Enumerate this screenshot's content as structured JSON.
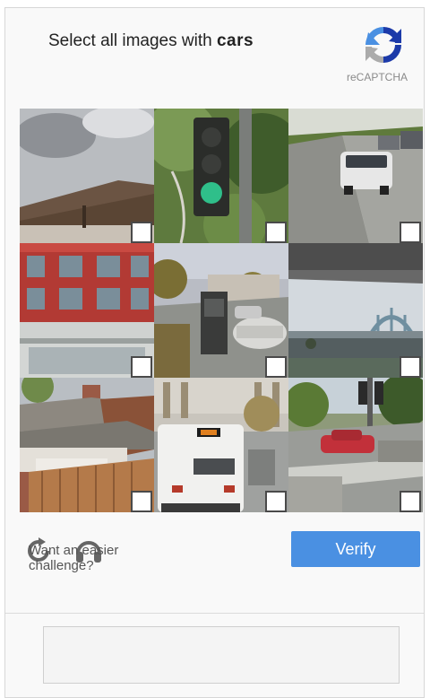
{
  "header": {
    "instruction_prefix": "Select all images with ",
    "target_word": "cars",
    "brand_text": "reCAPTCHA"
  },
  "grid": {
    "tiles": [
      {
        "name": "building-roof",
        "selected": false
      },
      {
        "name": "traffic-light",
        "selected": false
      },
      {
        "name": "road-with-suv",
        "selected": false
      },
      {
        "name": "red-building",
        "selected": false
      },
      {
        "name": "street-with-car",
        "selected": false
      },
      {
        "name": "bridge",
        "selected": false
      },
      {
        "name": "house-garage",
        "selected": false
      },
      {
        "name": "bus",
        "selected": false
      },
      {
        "name": "intersection-red-car",
        "selected": false
      }
    ]
  },
  "footer": {
    "easier_text": "Want an easier challenge?",
    "verify_label": "Verify"
  },
  "colors": {
    "accent": "#4a90e2",
    "logo_blue": "#1c3aa9",
    "logo_light_blue": "#4a90e2",
    "logo_grey": "#ababab"
  },
  "icons": [
    "recaptcha-logo-icon",
    "reload-icon",
    "headphones-icon",
    "checkbox-icon"
  ]
}
